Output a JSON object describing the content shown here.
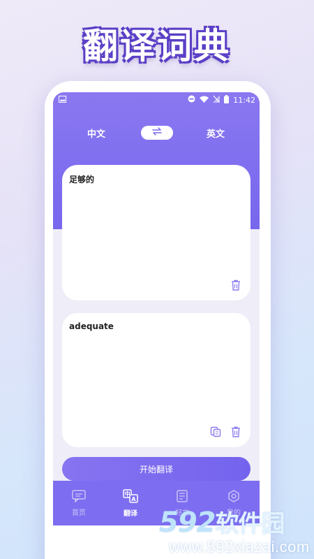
{
  "promo": {
    "title": "翻译词典"
  },
  "status_bar": {
    "time": "11:42"
  },
  "languages": {
    "from": "中文",
    "to": "英文",
    "swap_icon": "swap-arrows-icon"
  },
  "input_card": {
    "text": "足够的",
    "delete_icon": "trash-icon"
  },
  "output_card": {
    "text": "adequate",
    "copy_icon": "copy-icon",
    "delete_icon": "trash-icon"
  },
  "translate_button": {
    "label": "开始翻译"
  },
  "bottom_nav": {
    "items": [
      {
        "label": "首页",
        "icon": "chat-icon",
        "active": false
      },
      {
        "label": "翻译",
        "icon": "translate-icon",
        "active": true
      },
      {
        "label": "好文",
        "icon": "article-icon",
        "active": false
      },
      {
        "label": "我的",
        "icon": "settings-icon",
        "active": false
      }
    ]
  },
  "watermark": {
    "brand_digits": "592",
    "brand_text": "软件园",
    "url": "www.592xiazai.com"
  },
  "colors": {
    "accent": "#7a68ee",
    "background": "#efedf8",
    "title_outline": "#5b3fc6"
  }
}
